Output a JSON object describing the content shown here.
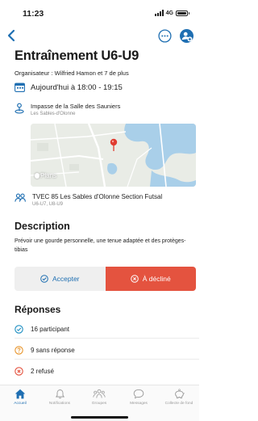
{
  "status_bar": {
    "time": "11:23",
    "network": "4G"
  },
  "event": {
    "title": "Entraînement U6-U9",
    "organizer": "Organisateur : Wilfried Hamon et 7 de plus",
    "date": "Aujourd'hui à 18:00 - 19:15",
    "place_name": "Impasse de la Salle des Sauniers",
    "place_city": "Les Sables-d'Olonne",
    "map_brand": "Plans",
    "team_name": "TVEC 85 Les Sables d'Olonne Section Futsal",
    "team_groups": "U6-U7, U8-U9"
  },
  "description": {
    "heading": "Description",
    "text": "Prévoir une gourde personnelle, une tenue adaptée et des protèges-tibias"
  },
  "actions": {
    "accept": "Accepter",
    "decline": "À décliné"
  },
  "responses": {
    "heading": "Réponses",
    "items": [
      {
        "label": "16 participant",
        "status": "accepted"
      },
      {
        "label": "9 sans réponse",
        "status": "pending"
      },
      {
        "label": "2 refusé",
        "status": "declined"
      }
    ]
  },
  "tabbar": {
    "items": [
      {
        "label": "Accueil",
        "icon": "home-icon",
        "active": true
      },
      {
        "label": "Notifications",
        "icon": "bell-icon",
        "active": false
      },
      {
        "label": "Groupes",
        "icon": "groups-icon",
        "active": false
      },
      {
        "label": "Messages",
        "icon": "chat-icon",
        "active": false
      },
      {
        "label": "Collecte de fond",
        "icon": "piggy-bank-icon",
        "active": false
      }
    ]
  },
  "colors": {
    "accent": "#1f6fb2",
    "decline": "#e4533f",
    "pending": "#e8962e",
    "accepted": "#1f8fc2",
    "declined_icon": "#e4533f"
  }
}
